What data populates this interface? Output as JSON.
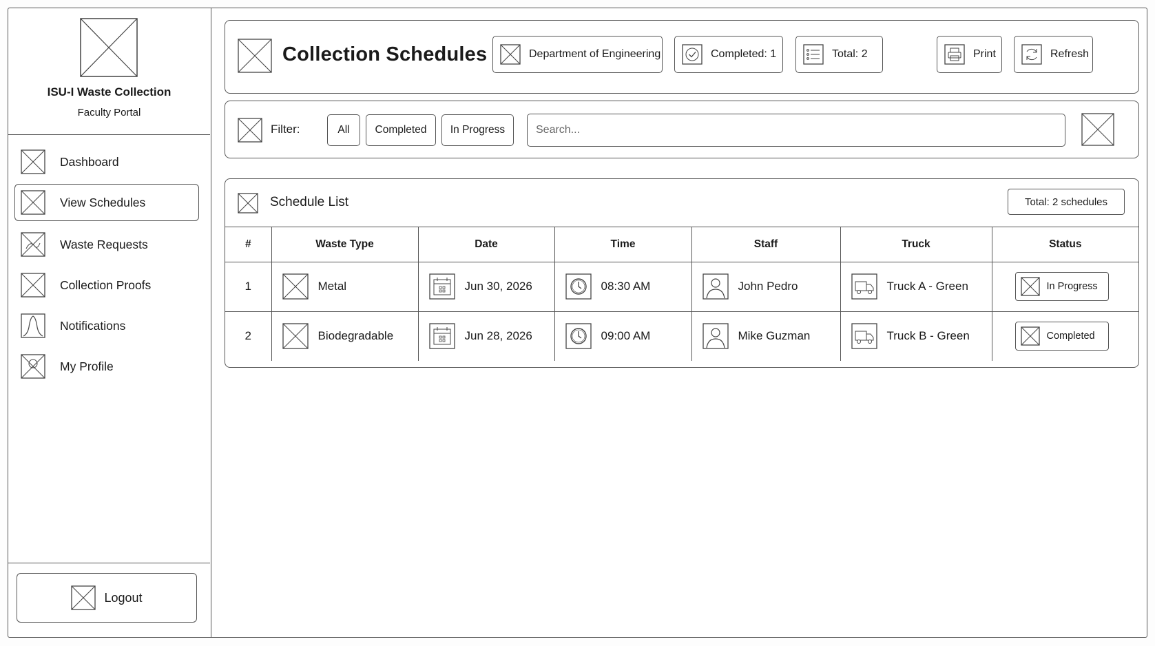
{
  "sidebar": {
    "app_name": "ISU-I Waste Collection",
    "portal": "Faculty Portal",
    "items": [
      {
        "label": "Dashboard",
        "icon": "placeholder-icon"
      },
      {
        "label": "View Schedules",
        "icon": "placeholder-icon",
        "active": true
      },
      {
        "label": "Waste Requests",
        "icon": "waste-request-icon"
      },
      {
        "label": "Collection Proofs",
        "icon": "placeholder-icon"
      },
      {
        "label": "Notifications",
        "icon": "bell-icon"
      },
      {
        "label": "My Profile",
        "icon": "profile-icon"
      }
    ],
    "logout_label": "Logout"
  },
  "header": {
    "title": "Collection Schedules",
    "department": "Department of Engineering",
    "completed": "Completed: 1",
    "total": "Total:  2",
    "print_label": "Print",
    "refresh_label": "Refresh"
  },
  "filter": {
    "label": "Filter:",
    "options": [
      "All",
      "Completed",
      "In Progress"
    ],
    "search_placeholder": "Search..."
  },
  "list": {
    "title": "Schedule List",
    "total_badge": "Total: 2 schedules",
    "columns": [
      "#",
      "Waste Type",
      "Date",
      "Time",
      "Staff",
      "Truck",
      "Status"
    ],
    "rows": [
      {
        "num": "1",
        "waste_type": "Metal",
        "date": "Jun 30, 2026",
        "time": "08:30 AM",
        "staff": "John Pedro",
        "truck": "Truck A - Green",
        "status": "In Progress"
      },
      {
        "num": "2",
        "waste_type": "Biodegradable",
        "date": "Jun 28, 2026",
        "time": "09:00 AM",
        "staff": "Mike Guzman",
        "truck": "Truck B - Green",
        "status": "Completed"
      }
    ]
  }
}
